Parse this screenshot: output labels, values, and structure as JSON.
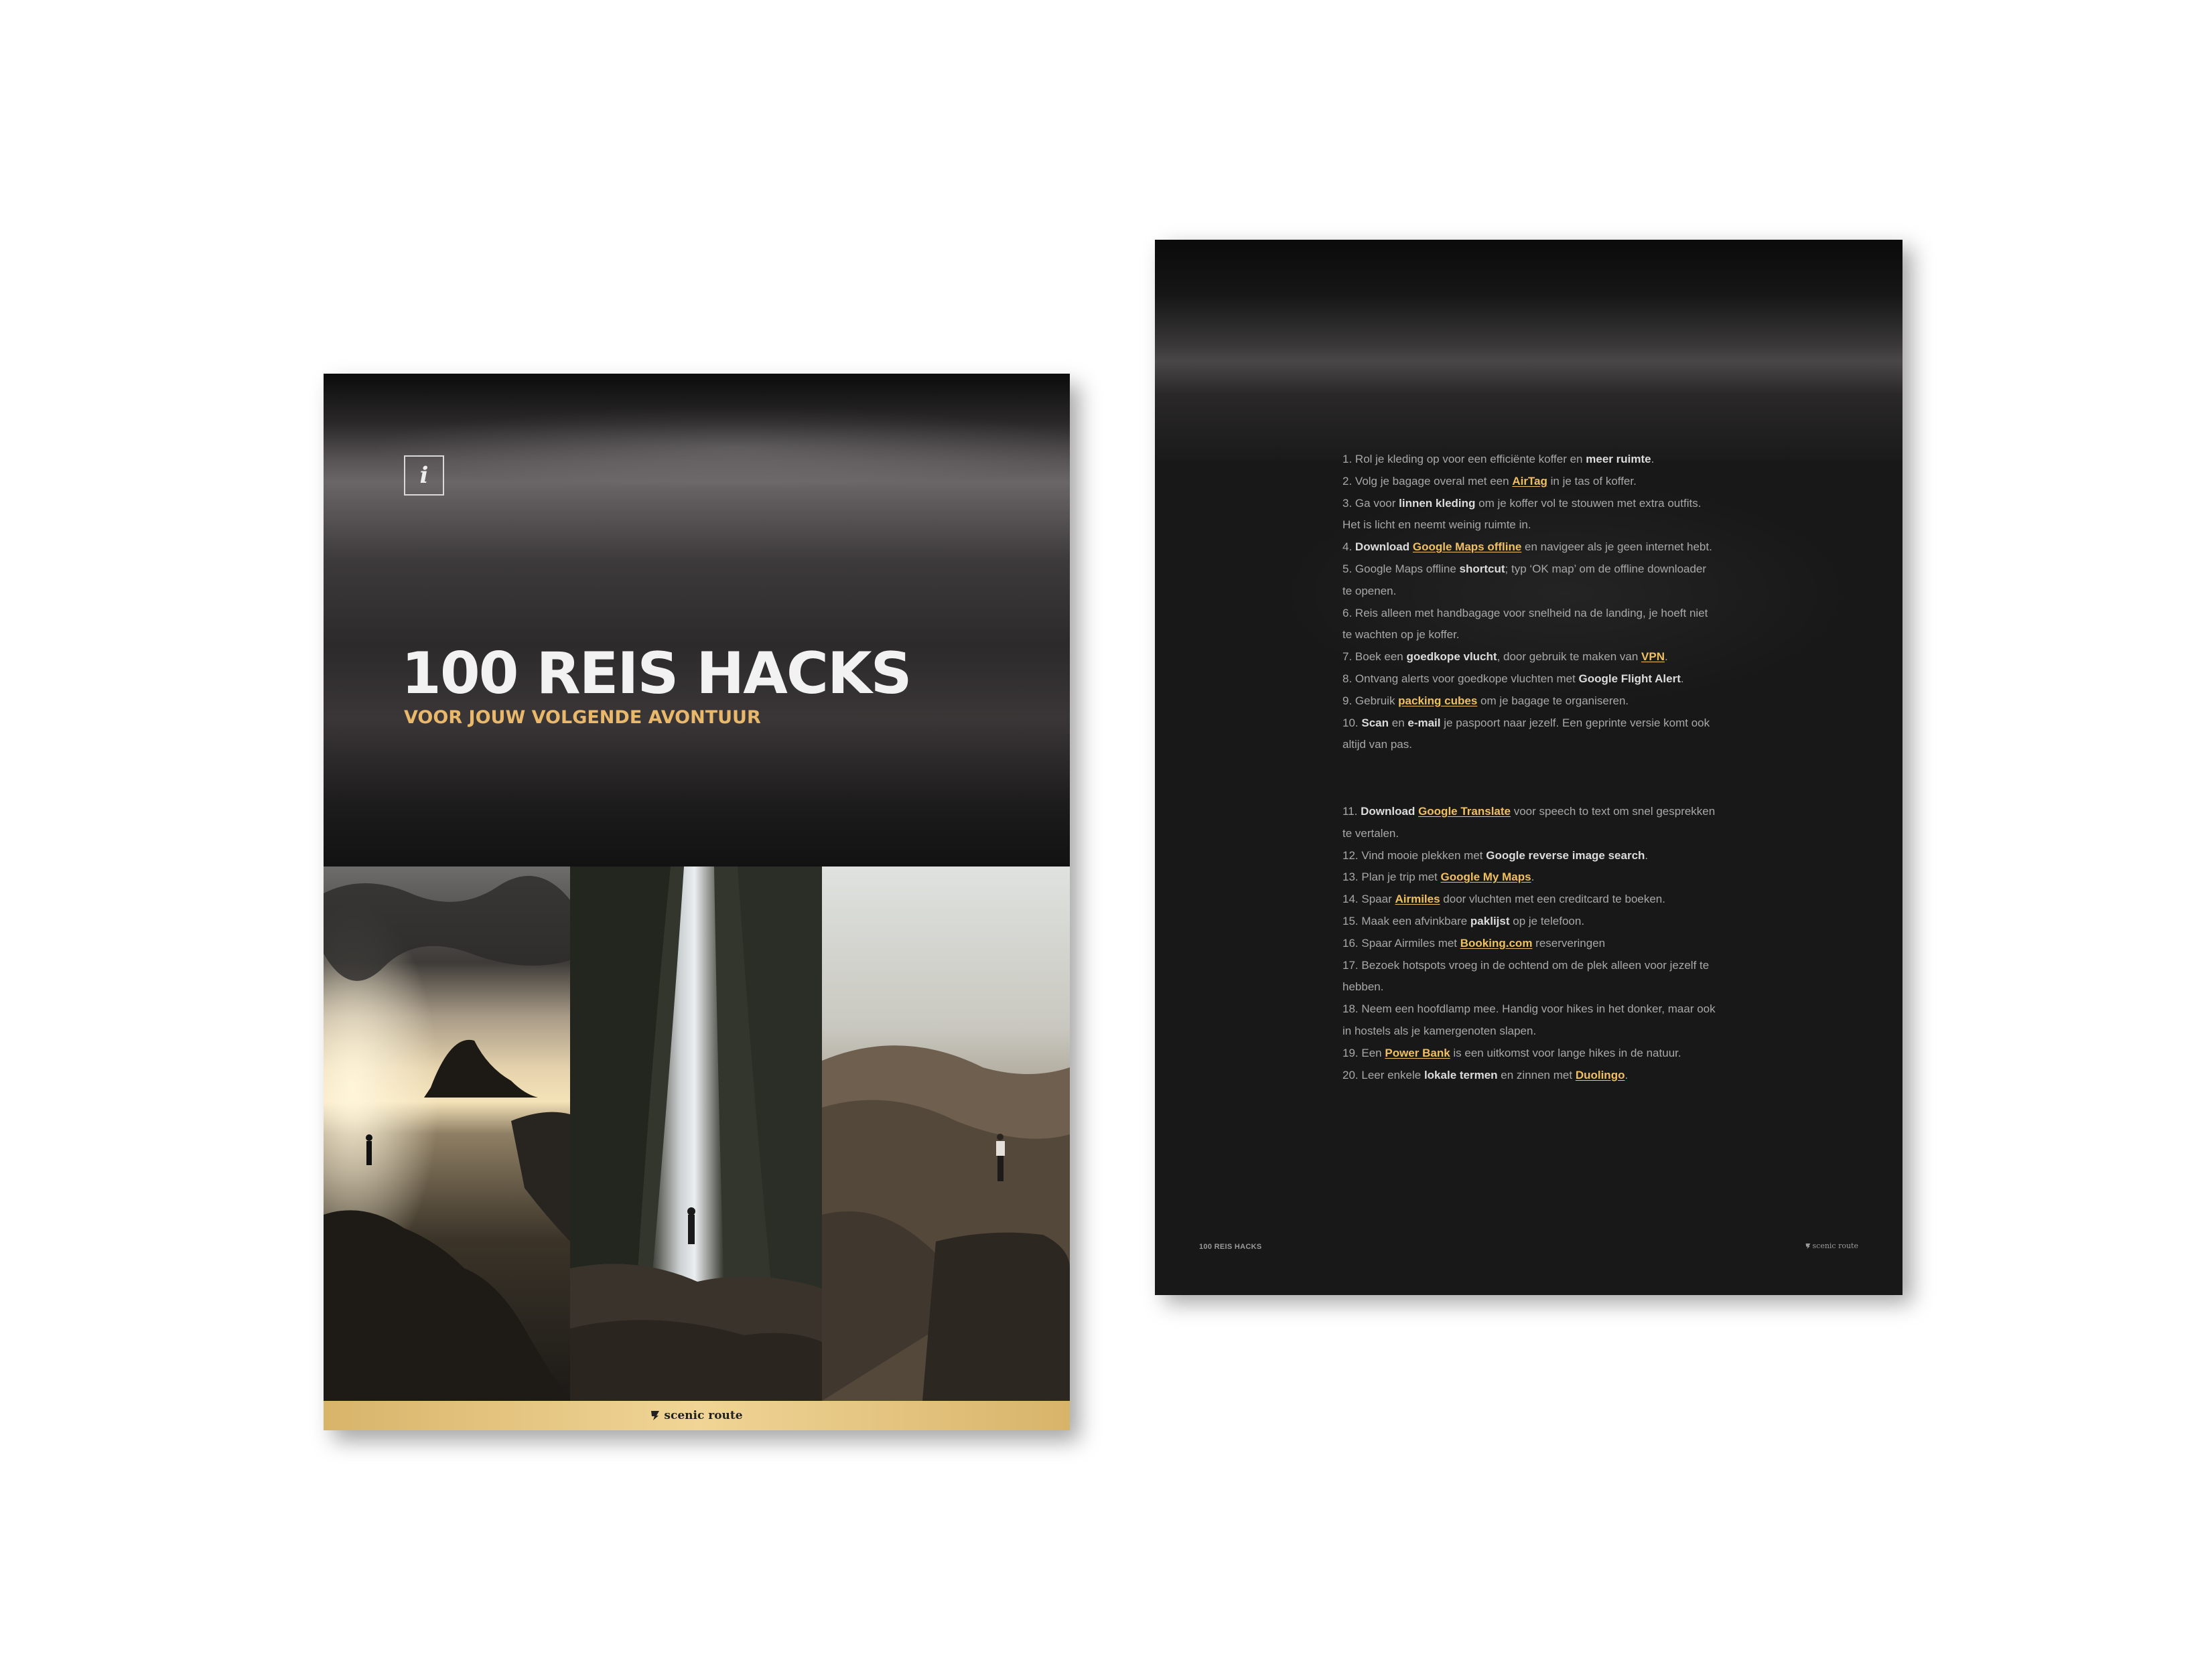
{
  "cover": {
    "info_glyph": "i",
    "title": "100 REIS HACKS",
    "subtitle": "VOOR JOUW VOLGENDE AVONTUUR",
    "brand": "scenic route",
    "accent_color": "#e9b86a",
    "footer_color": "#e6c47e"
  },
  "page": {
    "footer_left": "100 REIS HACKS",
    "footer_right": "scenic route",
    "highlight_color": "#f0c060",
    "hacks": [
      {
        "n": "1.",
        "parts": [
          {
            "t": "Rol je kleding op voor een efficiënte koffer en "
          },
          {
            "t": "meer ruimte",
            "s": "b"
          },
          {
            "t": "."
          }
        ]
      },
      {
        "n": "2.",
        "parts": [
          {
            "t": "Volg je bagage overal met een "
          },
          {
            "t": "AirTag",
            "s": "hl"
          },
          {
            "t": " in je tas of koffer."
          }
        ]
      },
      {
        "n": "3.",
        "parts": [
          {
            "t": "Ga voor "
          },
          {
            "t": "linnen kleding",
            "s": "b"
          },
          {
            "t": " om je koffer vol te stouwen met extra outfits. Het is licht en neemt weinig ruimte in."
          }
        ]
      },
      {
        "n": "4.",
        "parts": [
          {
            "t": "Download",
            "s": "b"
          },
          {
            "t": " "
          },
          {
            "t": "Google Maps offline",
            "s": "hl"
          },
          {
            "t": " en navigeer als je geen internet hebt."
          }
        ]
      },
      {
        "n": "5.",
        "parts": [
          {
            "t": "Google Maps offline "
          },
          {
            "t": "shortcut",
            "s": "b"
          },
          {
            "t": "; typ ‘OK map’ om de offline downloader te openen."
          }
        ]
      },
      {
        "n": "6.",
        "parts": [
          {
            "t": "Reis alleen met handbagage voor snelheid na de landing, je hoeft niet te wachten op je koffer."
          }
        ]
      },
      {
        "n": "7.",
        "parts": [
          {
            "t": "Boek een "
          },
          {
            "t": "goedkope vlucht",
            "s": "b"
          },
          {
            "t": ", door gebruik te maken van "
          },
          {
            "t": "VPN",
            "s": "hl"
          },
          {
            "t": "."
          }
        ]
      },
      {
        "n": "8.",
        "parts": [
          {
            "t": "Ontvang alerts voor goedkope vluchten met "
          },
          {
            "t": "Google Flight Alert",
            "s": "b"
          },
          {
            "t": "."
          }
        ]
      },
      {
        "n": "9.",
        "parts": [
          {
            "t": "Gebruik "
          },
          {
            "t": "packing cubes",
            "s": "hl"
          },
          {
            "t": " om je bagage te organiseren."
          }
        ]
      },
      {
        "n": "10.",
        "parts": [
          {
            "t": "Scan",
            "s": "b"
          },
          {
            "t": " en "
          },
          {
            "t": "e-mail",
            "s": "b"
          },
          {
            "t": " je paspoort naar jezelf. Een geprinte versie komt ook altijd van pas."
          }
        ]
      },
      {
        "n": "11.",
        "parts": [
          {
            "t": "Download",
            "s": "b"
          },
          {
            "t": " "
          },
          {
            "t": "Google Translate",
            "s": "hl"
          },
          {
            "t": " voor speech to text om snel gesprekken te vertalen."
          }
        ]
      },
      {
        "n": "12.",
        "parts": [
          {
            "t": "Vind mooie plekken met "
          },
          {
            "t": "Google reverse image search",
            "s": "b"
          },
          {
            "t": "."
          }
        ]
      },
      {
        "n": "13.",
        "parts": [
          {
            "t": "Plan je trip met "
          },
          {
            "t": "Google My Maps",
            "s": "hl"
          },
          {
            "t": "."
          }
        ]
      },
      {
        "n": "14.",
        "parts": [
          {
            "t": "Spaar "
          },
          {
            "t": "Airmiles",
            "s": "hl"
          },
          {
            "t": " door vluchten met een creditcard te boeken."
          }
        ]
      },
      {
        "n": "15.",
        "parts": [
          {
            "t": "Maak een afvinkbare "
          },
          {
            "t": "paklijst",
            "s": "b"
          },
          {
            "t": " op je telefoon."
          }
        ]
      },
      {
        "n": "16.",
        "parts": [
          {
            "t": "Spaar Airmiles met "
          },
          {
            "t": "Booking.com",
            "s": "hl"
          },
          {
            "t": " reserveringen"
          }
        ]
      },
      {
        "n": "17.",
        "parts": [
          {
            "t": "Bezoek hotspots vroeg in de ochtend om de plek alleen voor jezelf te hebben."
          }
        ]
      },
      {
        "n": "18.",
        "parts": [
          {
            "t": "Neem een hoofdlamp mee. Handig voor hikes in het donker, maar ook in hostels als je kamergenoten slapen."
          }
        ]
      },
      {
        "n": "19.",
        "parts": [
          {
            "t": "Een "
          },
          {
            "t": "Power Bank",
            "s": "hl"
          },
          {
            "t": " is een uitkomst voor lange hikes in de natuur."
          }
        ]
      },
      {
        "n": "20.",
        "parts": [
          {
            "t": "Leer enkele "
          },
          {
            "t": "lokale termen",
            "s": "b"
          },
          {
            "t": " en zinnen met "
          },
          {
            "t": "Duolingo",
            "s": "hl"
          },
          {
            "t": "."
          }
        ]
      }
    ]
  }
}
